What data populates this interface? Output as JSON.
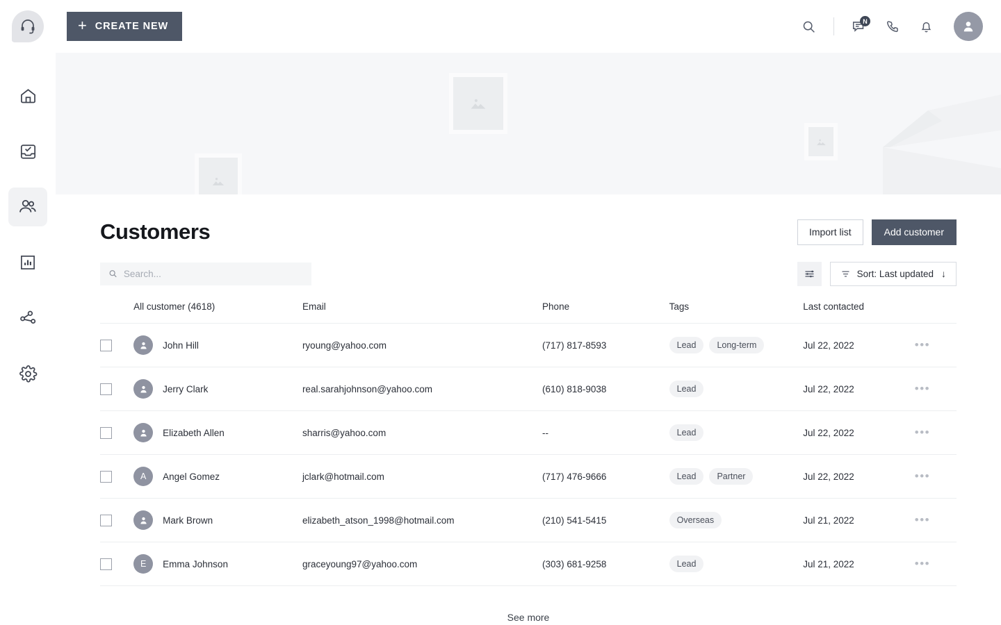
{
  "topbar": {
    "logo_icon": "headset-support-icon",
    "create_new_label": "CREATE NEW",
    "create_new_plus": "+",
    "icons": [
      {
        "name": "search-icon"
      },
      {
        "name": "messages-icon",
        "badge": "N"
      },
      {
        "name": "phone-icon"
      },
      {
        "name": "notifications-bell-icon"
      }
    ],
    "avatar_icon": "user-avatar-icon"
  },
  "sidebar": {
    "items": [
      {
        "name": "home-icon",
        "active": false
      },
      {
        "name": "tasks-inbox-icon",
        "active": false
      },
      {
        "name": "customers-people-icon",
        "active": true
      },
      {
        "name": "analytics-chart-icon",
        "active": false
      },
      {
        "name": "network-share-icon",
        "active": false
      },
      {
        "name": "settings-gear-icon",
        "active": false
      }
    ]
  },
  "banner": {
    "placeholder_icon": "image-placeholder-icon",
    "placeholders": 3
  },
  "page": {
    "title": "Customers",
    "import_label": "Import list",
    "add_label": "Add customer"
  },
  "search": {
    "placeholder": "Search...",
    "value": "",
    "icon": "search-icon"
  },
  "controls": {
    "filter_icon": "filter-sliders-icon",
    "sort_icon": "sort-lines-icon",
    "sort_label": "Sort: Last updated",
    "sort_direction": "↓"
  },
  "table": {
    "headers": {
      "name": "All customer (4618)",
      "email": "Email",
      "phone": "Phone",
      "tags": "Tags",
      "last_contacted": "Last contacted"
    },
    "rows": [
      {
        "name": "John Hill",
        "avatar_initial": "",
        "email": "ryoung@yahoo.com",
        "phone": "(717) 817-8593",
        "tags": [
          "Lead",
          "Long-term"
        ],
        "last_contacted": "Jul 22, 2022",
        "menu": "•••"
      },
      {
        "name": "Jerry Clark",
        "avatar_initial": "",
        "email": "real.sarahjohnson@yahoo.com",
        "phone": "(610) 818-9038",
        "tags": [
          "Lead"
        ],
        "last_contacted": "Jul 22, 2022",
        "menu": "•••"
      },
      {
        "name": "Elizabeth Allen",
        "avatar_initial": "",
        "email": "sharris@yahoo.com",
        "phone": "--",
        "tags": [
          "Lead"
        ],
        "last_contacted": "Jul 22, 2022",
        "menu": "•••"
      },
      {
        "name": "Angel Gomez",
        "avatar_initial": "A",
        "email": "jclark@hotmail.com",
        "phone": "(717) 476-9666",
        "tags": [
          "Lead",
          "Partner"
        ],
        "last_contacted": "Jul 22, 2022",
        "menu": "•••"
      },
      {
        "name": "Mark Brown",
        "avatar_initial": "",
        "email": "elizabeth_atson_1998@hotmail.com",
        "phone": "(210) 541-5415",
        "tags": [
          "Overseas"
        ],
        "last_contacted": "Jul 21, 2022",
        "menu": "•••"
      },
      {
        "name": "Emma Johnson",
        "avatar_initial": "E",
        "email": "graceyoung97@yahoo.com",
        "phone": "(303) 681-9258",
        "tags": [
          "Lead"
        ],
        "last_contacted": "Jul 21, 2022",
        "menu": "•••"
      }
    ],
    "see_more_label": "See more"
  },
  "colors": {
    "accent_dark": "#4e5767",
    "banner_bg": "#f6f7f9",
    "avatar_gray": "#8f93a1",
    "tag_bg": "#f1f2f4",
    "border": "#eceef0"
  }
}
